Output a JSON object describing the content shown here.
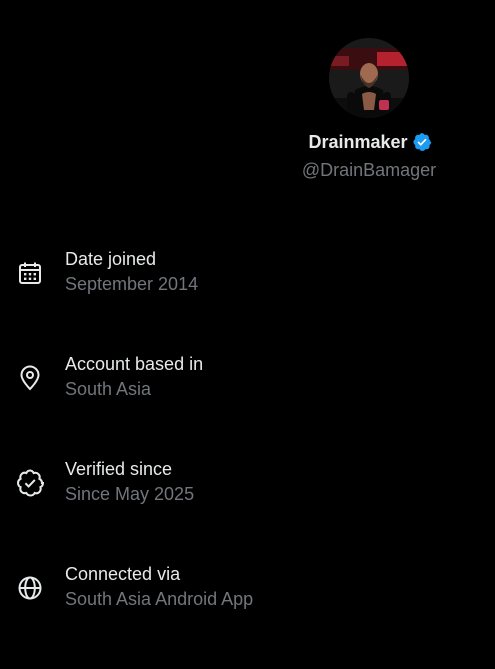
{
  "profile": {
    "display_name": "Drainmaker",
    "handle": "@DrainBamager",
    "verified_color": "#1d9bf0"
  },
  "info_items": [
    {
      "icon": "calendar-icon",
      "title": "Date joined",
      "value": "September 2014"
    },
    {
      "icon": "location-pin-icon",
      "title": "Account based in",
      "value": "South Asia"
    },
    {
      "icon": "verified-badge-icon",
      "title": "Verified since",
      "value": "Since May 2025"
    },
    {
      "icon": "globe-icon",
      "title": "Connected via",
      "value": "South Asia Android App"
    }
  ],
  "colors": {
    "background": "#000000",
    "primary_text": "#e7e9ea",
    "secondary_text": "#71767b"
  }
}
